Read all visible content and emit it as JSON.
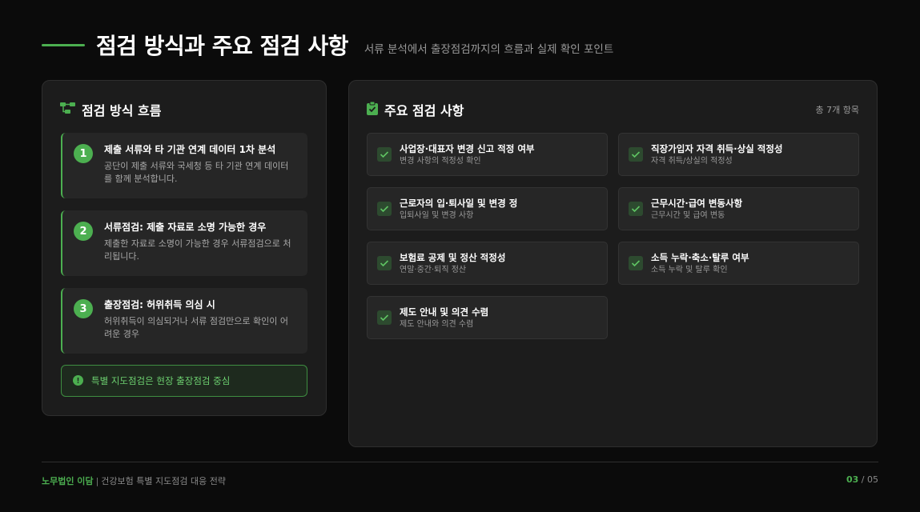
{
  "header": {
    "title": "점검 방식과 주요 점검 사항",
    "subtitle": "서류 분석에서 출장점검까지의 흐름과 실제 확인 포인트"
  },
  "flow": {
    "title": "점검 방식 흐름",
    "icon": "flow-icon",
    "steps": [
      {
        "num": "1",
        "title": "제출 서류와 타 기관 연계 데이터 1차 분석",
        "desc": "공단이 제출 서류와 국세청 등 타 기관 연계 데이터를 함께 분석합니다."
      },
      {
        "num": "2",
        "title": "서류점검: 제출 자료로 소명 가능한 경우",
        "desc": "제출한 자료로 소명이 가능한 경우 서류점검으로 처리됩니다."
      },
      {
        "num": "3",
        "title": "출장점검: 허위취득 의심 시",
        "desc": "허위취득이 의심되거나 서류 점검만으로 확인이 어려운 경우"
      }
    ],
    "notice": "특별 지도점검은 현장 출장점검 중심"
  },
  "items": {
    "title": "주요 점검 사항",
    "icon": "clipboard-check-icon",
    "count": "총 7개 항목",
    "list": [
      {
        "title": "사업장·대표자 변경 신고 적정 여부",
        "desc": "변경 사항의 적정성 확인"
      },
      {
        "title": "직장가입자 자격 취득·상실 적정성",
        "desc": "자격 취득/상실의 적정성"
      },
      {
        "title": "근로자의 입·퇴사일 및 변경 정",
        "desc": "입퇴사일 및 변경 사항"
      },
      {
        "title": "근무시간·급여 변동사항",
        "desc": "근무시간 및 급여 변동"
      },
      {
        "title": "보험료 공제 및 정산 적정성",
        "desc": "연말·중간·퇴직 정산"
      },
      {
        "title": "소득 누락·축소·탈루 여부",
        "desc": "소득 누락 및 탈루 확인"
      },
      {
        "title": "제도 안내 및 의견 수렴",
        "desc": "제도 안내와 의견 수렴"
      }
    ]
  },
  "footer": {
    "brand": "노무법인 이담",
    "separator": "|",
    "subtitle": "건강보험 특별 지도점검 대응 전략",
    "page_current": "03",
    "page_total": "/ 05"
  },
  "colors": {
    "accent": "#4caf50",
    "background": "#0b0b0b",
    "panel": "#1c1c1c"
  }
}
